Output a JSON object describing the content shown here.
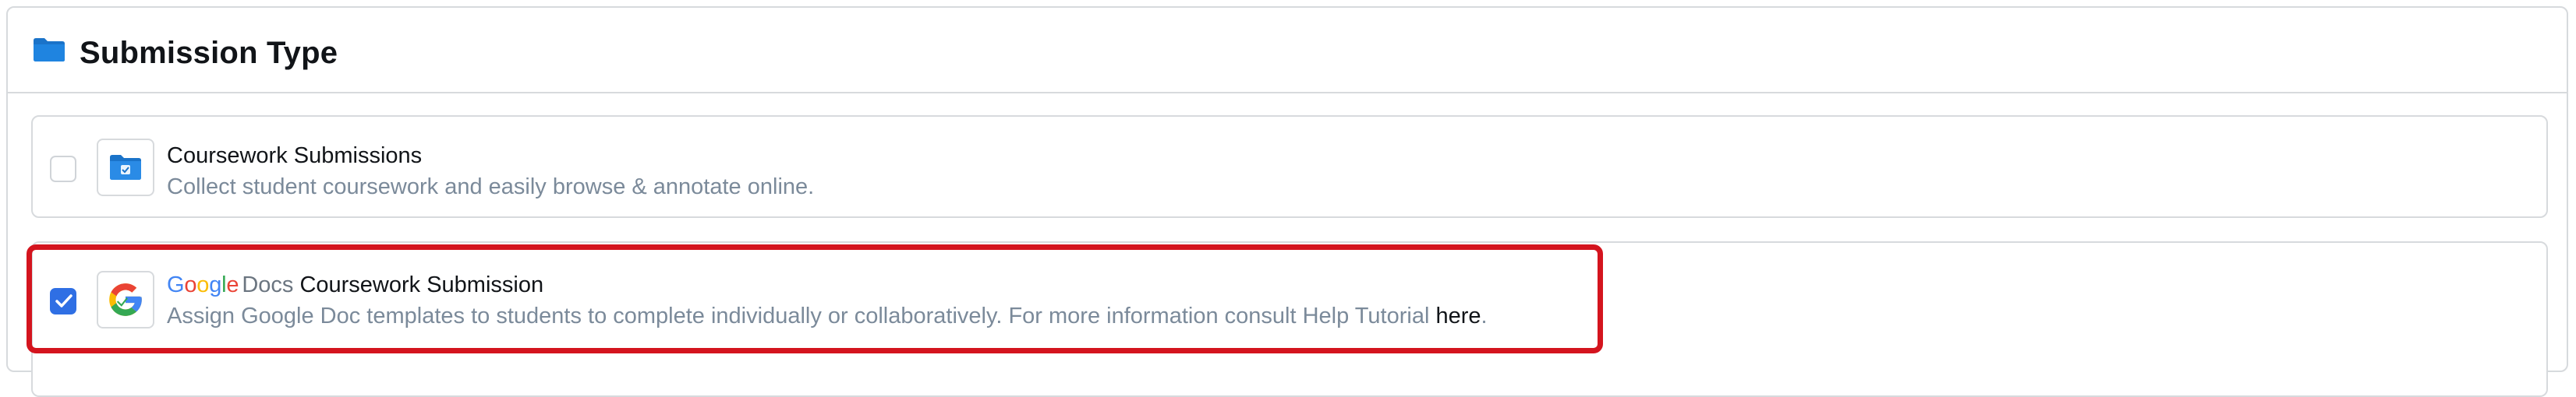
{
  "panel": {
    "title": "Submission Type",
    "title_icon": "folder-icon"
  },
  "options": [
    {
      "checked": false,
      "icon": "coursework-folder-icon",
      "title": "Coursework Submissions",
      "description": "Collect student coursework and easily browse & annotate online."
    },
    {
      "checked": true,
      "icon": "google-g-icon",
      "brand_google": "Google",
      "brand_docs": "Docs",
      "title": "Coursework Submission",
      "description": "Assign Google Doc templates to students to complete individually or collaboratively. For more information consult Help Tutorial ",
      "link_text": "here",
      "description_end": "."
    }
  ],
  "colors": {
    "checkbox_checked": "#2f6fe4",
    "highlight": "#d4141e",
    "description_text": "#7b8a9a",
    "folder_blue": "#1a73c9"
  }
}
